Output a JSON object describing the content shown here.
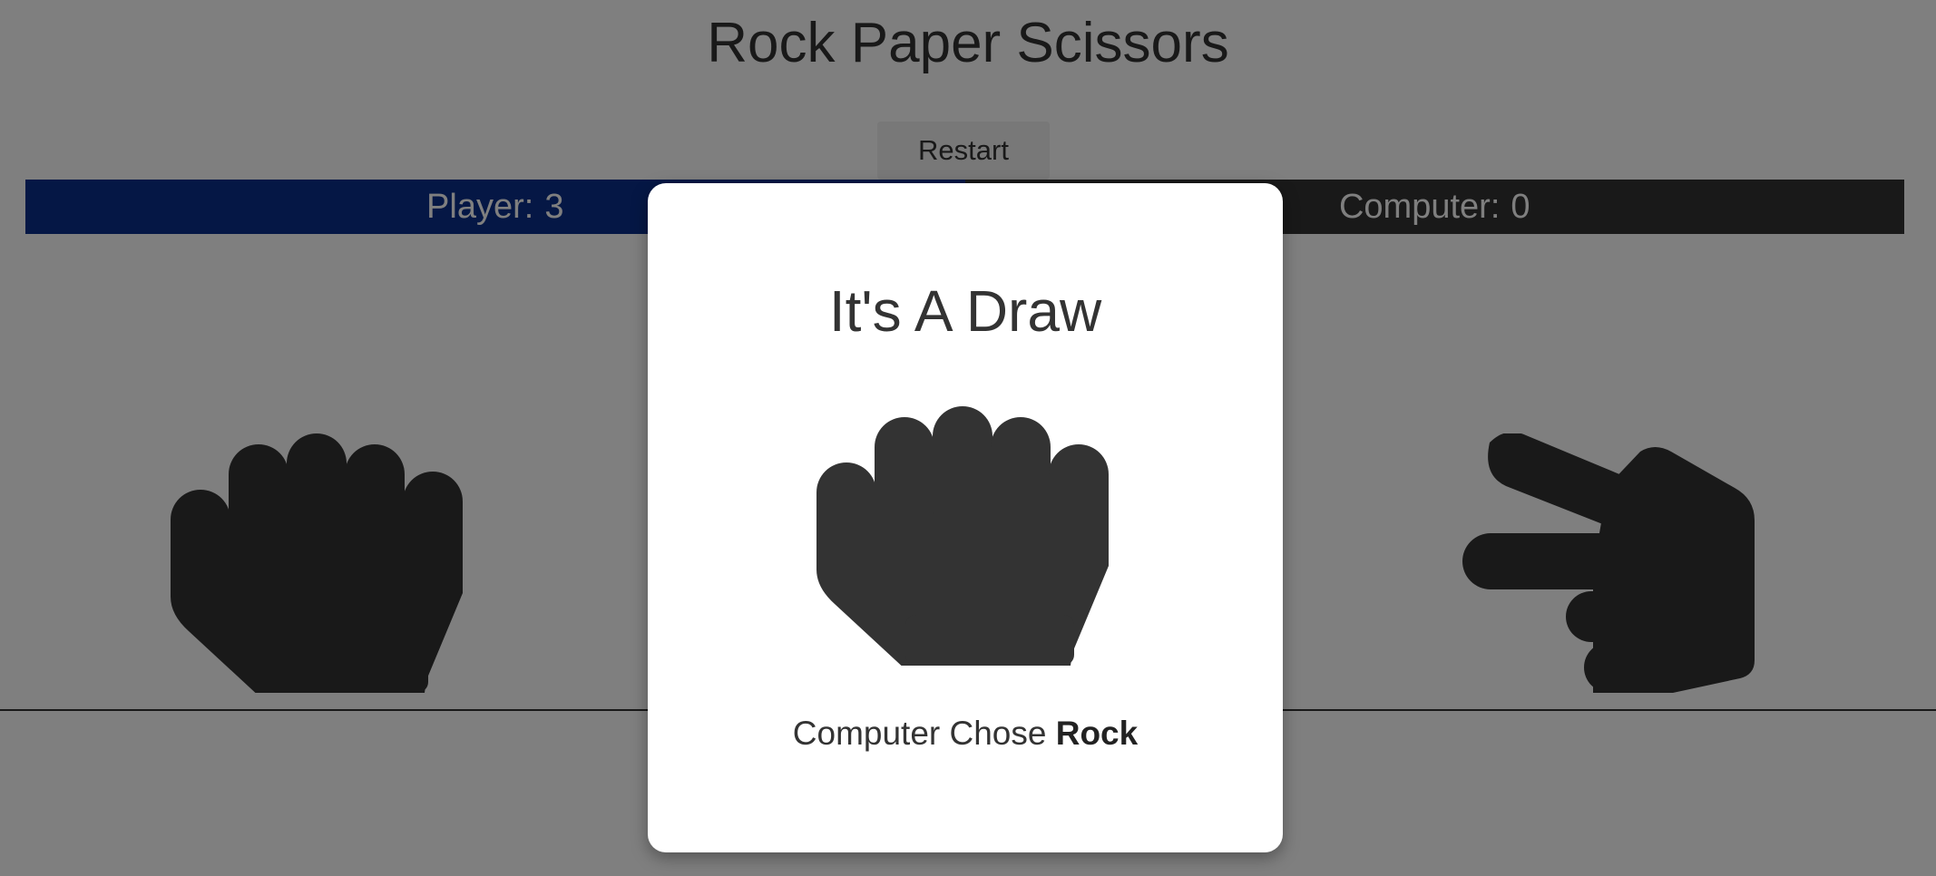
{
  "page": {
    "title": "Rock Paper Scissors"
  },
  "controls": {
    "restart_label": "Restart"
  },
  "scoreboard": {
    "player": {
      "label": "Player:",
      "score": "3"
    },
    "computer": {
      "label": "Computer:",
      "score": "0"
    },
    "player_color": "#0b2e8a",
    "computer_color": "#333333"
  },
  "board": {
    "player_choice_icon": "rock-hand-icon",
    "computer_choice_icon": "scissors-hand-icon"
  },
  "modal": {
    "title": "It's A Draw",
    "icon": "rock-hand-icon",
    "message_prefix": "Computer Chose",
    "computer_choice": "Rock"
  }
}
